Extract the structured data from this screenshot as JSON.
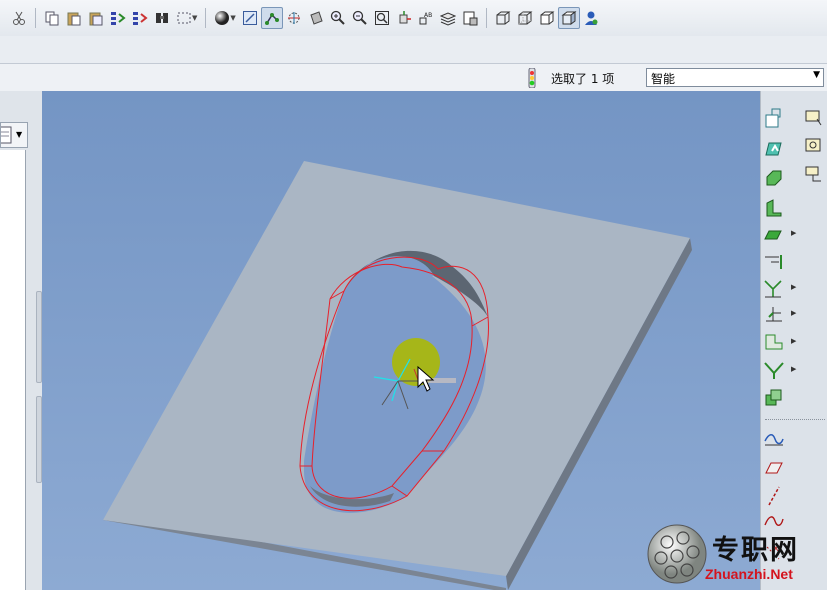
{
  "toolbar": {
    "icons": [
      "cut-icon",
      "copy-icon",
      "paste-icon",
      "paste-special-icon",
      "regenerate-icon",
      "regenerate-manager-icon",
      "find-icon",
      "select-box-icon",
      "shading-icon",
      "view-manager-icon",
      "datum-points-icon",
      "spin-center-icon",
      "orient-icon",
      "zoom-in-icon",
      "zoom-out-icon",
      "refit-icon",
      "reorient-icon",
      "annotation-icon",
      "layers-icon",
      "appearance-icon",
      "wireframe-icon",
      "hidden-line-icon",
      "no-hidden-icon",
      "shaded-icon",
      "model-tree-icon"
    ]
  },
  "status": {
    "selected_text": "选取了 1 项",
    "filter_value": "智能"
  },
  "right_toolbar": {
    "icons": [
      "hole-icon",
      "shell-icon",
      "rib-icon",
      "draft-icon",
      "round-icon",
      "chamfer-icon",
      "extrude-icon",
      "revolve-icon",
      "sweep-icon",
      "blend-icon",
      "mirror-icon",
      "merge-icon",
      "style-icon",
      "plane-icon",
      "axis-icon",
      "curve-icon",
      "point-icon",
      "datum-plane-icon",
      "datum-axis-icon",
      "datum-curve-icon",
      "datum-point-icon",
      "coord-sys-icon"
    ]
  },
  "watermark": {
    "cn": "专职网",
    "en": "Zhuanzhi.Net"
  },
  "colors": {
    "viewport_top": "#7495c4",
    "plate_top": "#aab6c4",
    "highlight_edge": "#e8202a",
    "spin_center": "#a9b80a"
  }
}
